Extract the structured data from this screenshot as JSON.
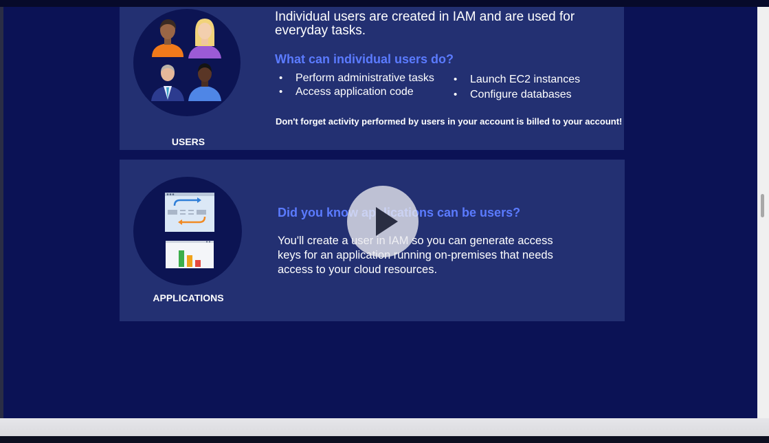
{
  "users": {
    "label": "USERS",
    "intro": "Individual users are created in IAM and are used for everyday tasks.",
    "heading": "What can individual users do?",
    "bullets_left": [
      "Perform administrative tasks",
      "Access application code"
    ],
    "bullets_right": [
      "Launch EC2 instances",
      "Configure databases"
    ],
    "note": "Don't forget activity performed by users in your account is billed to your account!"
  },
  "applications": {
    "label": "APPLICATIONS",
    "heading": "Did you know applications can be users?",
    "body": "You'll create a user in IAM so you can generate access keys for an application running on-premises that needs access to your cloud resources."
  },
  "bullet_glyph": "•",
  "colors": {
    "background": "#0b1255",
    "card": "#233072",
    "accent_heading": "#5b7bff",
    "text": "#ffffff"
  },
  "icons": [
    "users-avatars-illustration",
    "application-window-icon",
    "bar-chart-icon",
    "play-icon"
  ]
}
